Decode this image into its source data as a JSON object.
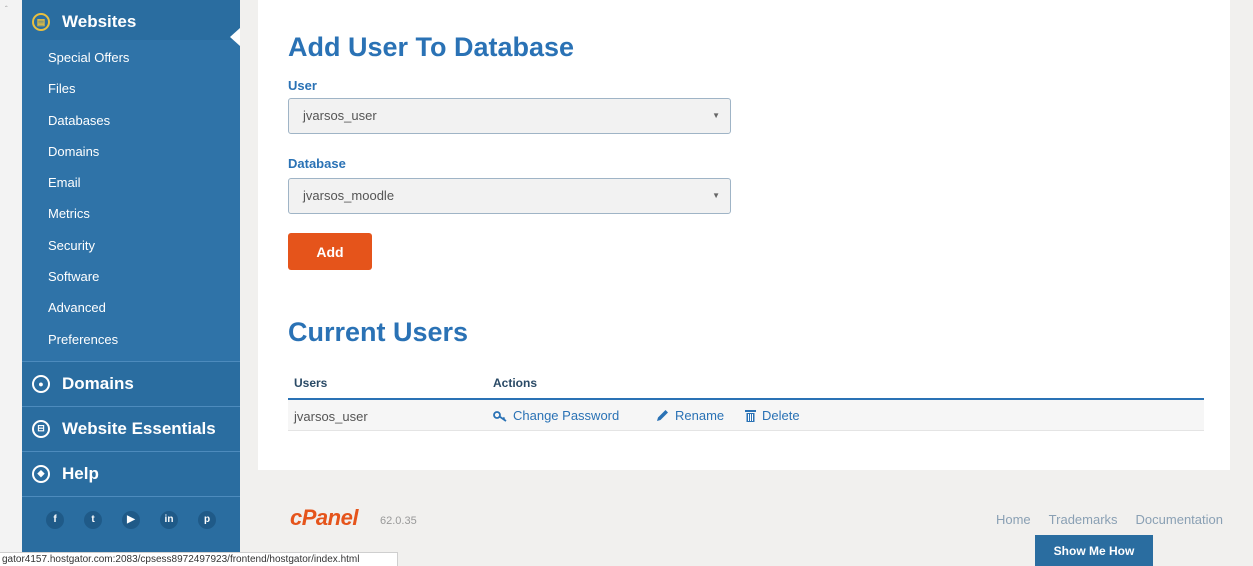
{
  "sidebar": {
    "active_section": "Websites",
    "items": [
      "Special Offers",
      "Files",
      "Databases",
      "Domains",
      "Email",
      "Metrics",
      "Security",
      "Software",
      "Advanced",
      "Preferences"
    ],
    "sections": [
      "Domains",
      "Website Essentials",
      "Help"
    ],
    "social": [
      "f",
      "t",
      "yt",
      "in",
      "p"
    ]
  },
  "form": {
    "title": "Add User To Database",
    "user_label": "User",
    "user_value": "jvarsos_user",
    "database_label": "Database",
    "database_value": "jvarsos_moodle",
    "add_label": "Add"
  },
  "current_users": {
    "title": "Current Users",
    "columns": [
      "Users",
      "Actions"
    ],
    "rows": [
      {
        "user": "jvarsos_user",
        "actions": [
          "Change Password",
          "Rename",
          "Delete"
        ]
      }
    ]
  },
  "footer": {
    "brand": "cPanel",
    "version": "62.0.35",
    "links": [
      "Home",
      "Trademarks",
      "Documentation"
    ],
    "show_me_how": "Show Me How"
  },
  "statusbar": {
    "url": "gator4157.hostgator.com:2083/cpsess8972497923/frontend/hostgator/index.html"
  },
  "colors": {
    "sidebar": "#2a6da0",
    "heading": "#2a72b5",
    "accent_button": "#e5541b",
    "brand": "#e5541b"
  }
}
